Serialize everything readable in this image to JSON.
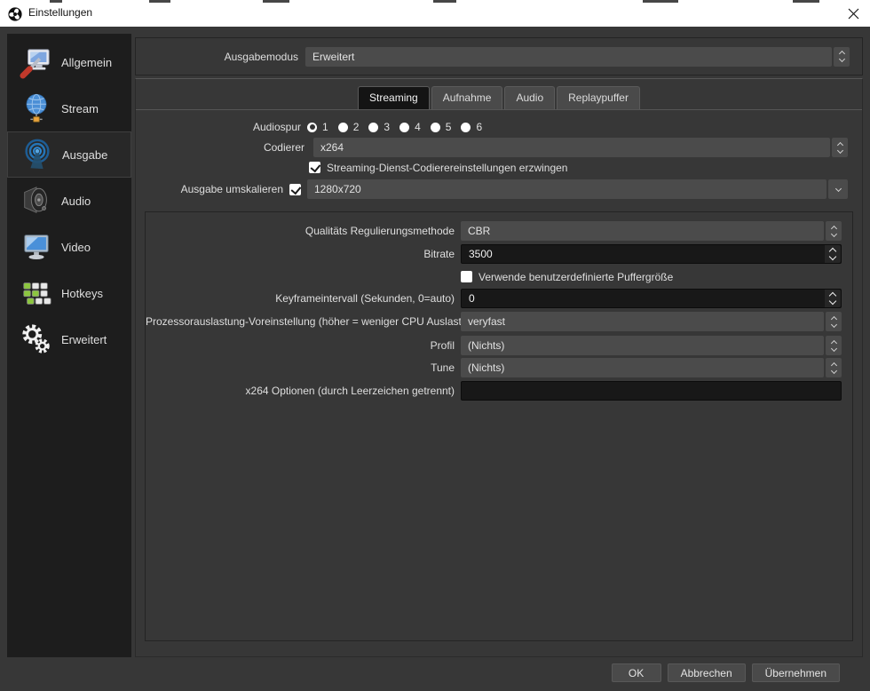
{
  "window": {
    "title": "Einstellungen"
  },
  "sidebar": {
    "items": [
      {
        "label": "Allgemein",
        "icon": "general-icon",
        "selected": false
      },
      {
        "label": "Stream",
        "icon": "stream-icon",
        "selected": false
      },
      {
        "label": "Ausgabe",
        "icon": "output-icon",
        "selected": true
      },
      {
        "label": "Audio",
        "icon": "audio-icon",
        "selected": false
      },
      {
        "label": "Video",
        "icon": "video-icon",
        "selected": false
      },
      {
        "label": "Hotkeys",
        "icon": "hotkeys-icon",
        "selected": false
      },
      {
        "label": "Erweitert",
        "icon": "advanced-icon",
        "selected": false
      }
    ]
  },
  "output_mode": {
    "label": "Ausgabemodus",
    "value": "Erweitert"
  },
  "tabs": [
    {
      "label": "Streaming",
      "selected": true
    },
    {
      "label": "Aufnahme",
      "selected": false
    },
    {
      "label": "Audio",
      "selected": false
    },
    {
      "label": "Replaypuffer",
      "selected": false
    }
  ],
  "streaming": {
    "audio_track": {
      "label": "Audiospur",
      "options": [
        "1",
        "2",
        "3",
        "4",
        "5",
        "6"
      ],
      "selected": "1"
    },
    "encoder": {
      "label": "Codierer",
      "value": "x264"
    },
    "enforce_settings": {
      "label": "Streaming-Dienst-Codierereinstellungen erzwingen",
      "checked": true
    },
    "rescale_output": {
      "label": "Ausgabe umskalieren",
      "checked": true,
      "value": "1280x720"
    },
    "encoder_settings": {
      "rate_control": {
        "label": "Qualitäts Regulierungsmethode",
        "value": "CBR"
      },
      "bitrate": {
        "label": "Bitrate",
        "value": "3500"
      },
      "custom_buffer": {
        "label": "Verwende benutzerdefinierte Puffergröße",
        "checked": false
      },
      "keyframe_interval": {
        "label": "Keyframeintervall (Sekunden, 0=auto)",
        "value": "0"
      },
      "cpu_preset": {
        "label": "Prozessorauslastung-Voreinstellung (höher = weniger CPU Auslastung)",
        "value": "veryfast"
      },
      "profile": {
        "label": "Profil",
        "value": "(Nichts)"
      },
      "tune": {
        "label": "Tune",
        "value": "(Nichts)"
      },
      "x264_options": {
        "label": "x264 Optionen (durch Leerzeichen getrennt)",
        "value": ""
      }
    }
  },
  "footer": {
    "ok": "OK",
    "cancel": "Abbrechen",
    "apply": "Übernehmen"
  },
  "colors": {
    "titlebar_bg": "#ffffff",
    "window_bg": "#373737",
    "sidebar_bg": "#1d1d1d",
    "control_bg": "#4b4b4b",
    "input_bg": "#181818",
    "tab_selected_bg": "#141414",
    "text": "#dfdfdf",
    "output_icon_accent": "#2574b5"
  }
}
